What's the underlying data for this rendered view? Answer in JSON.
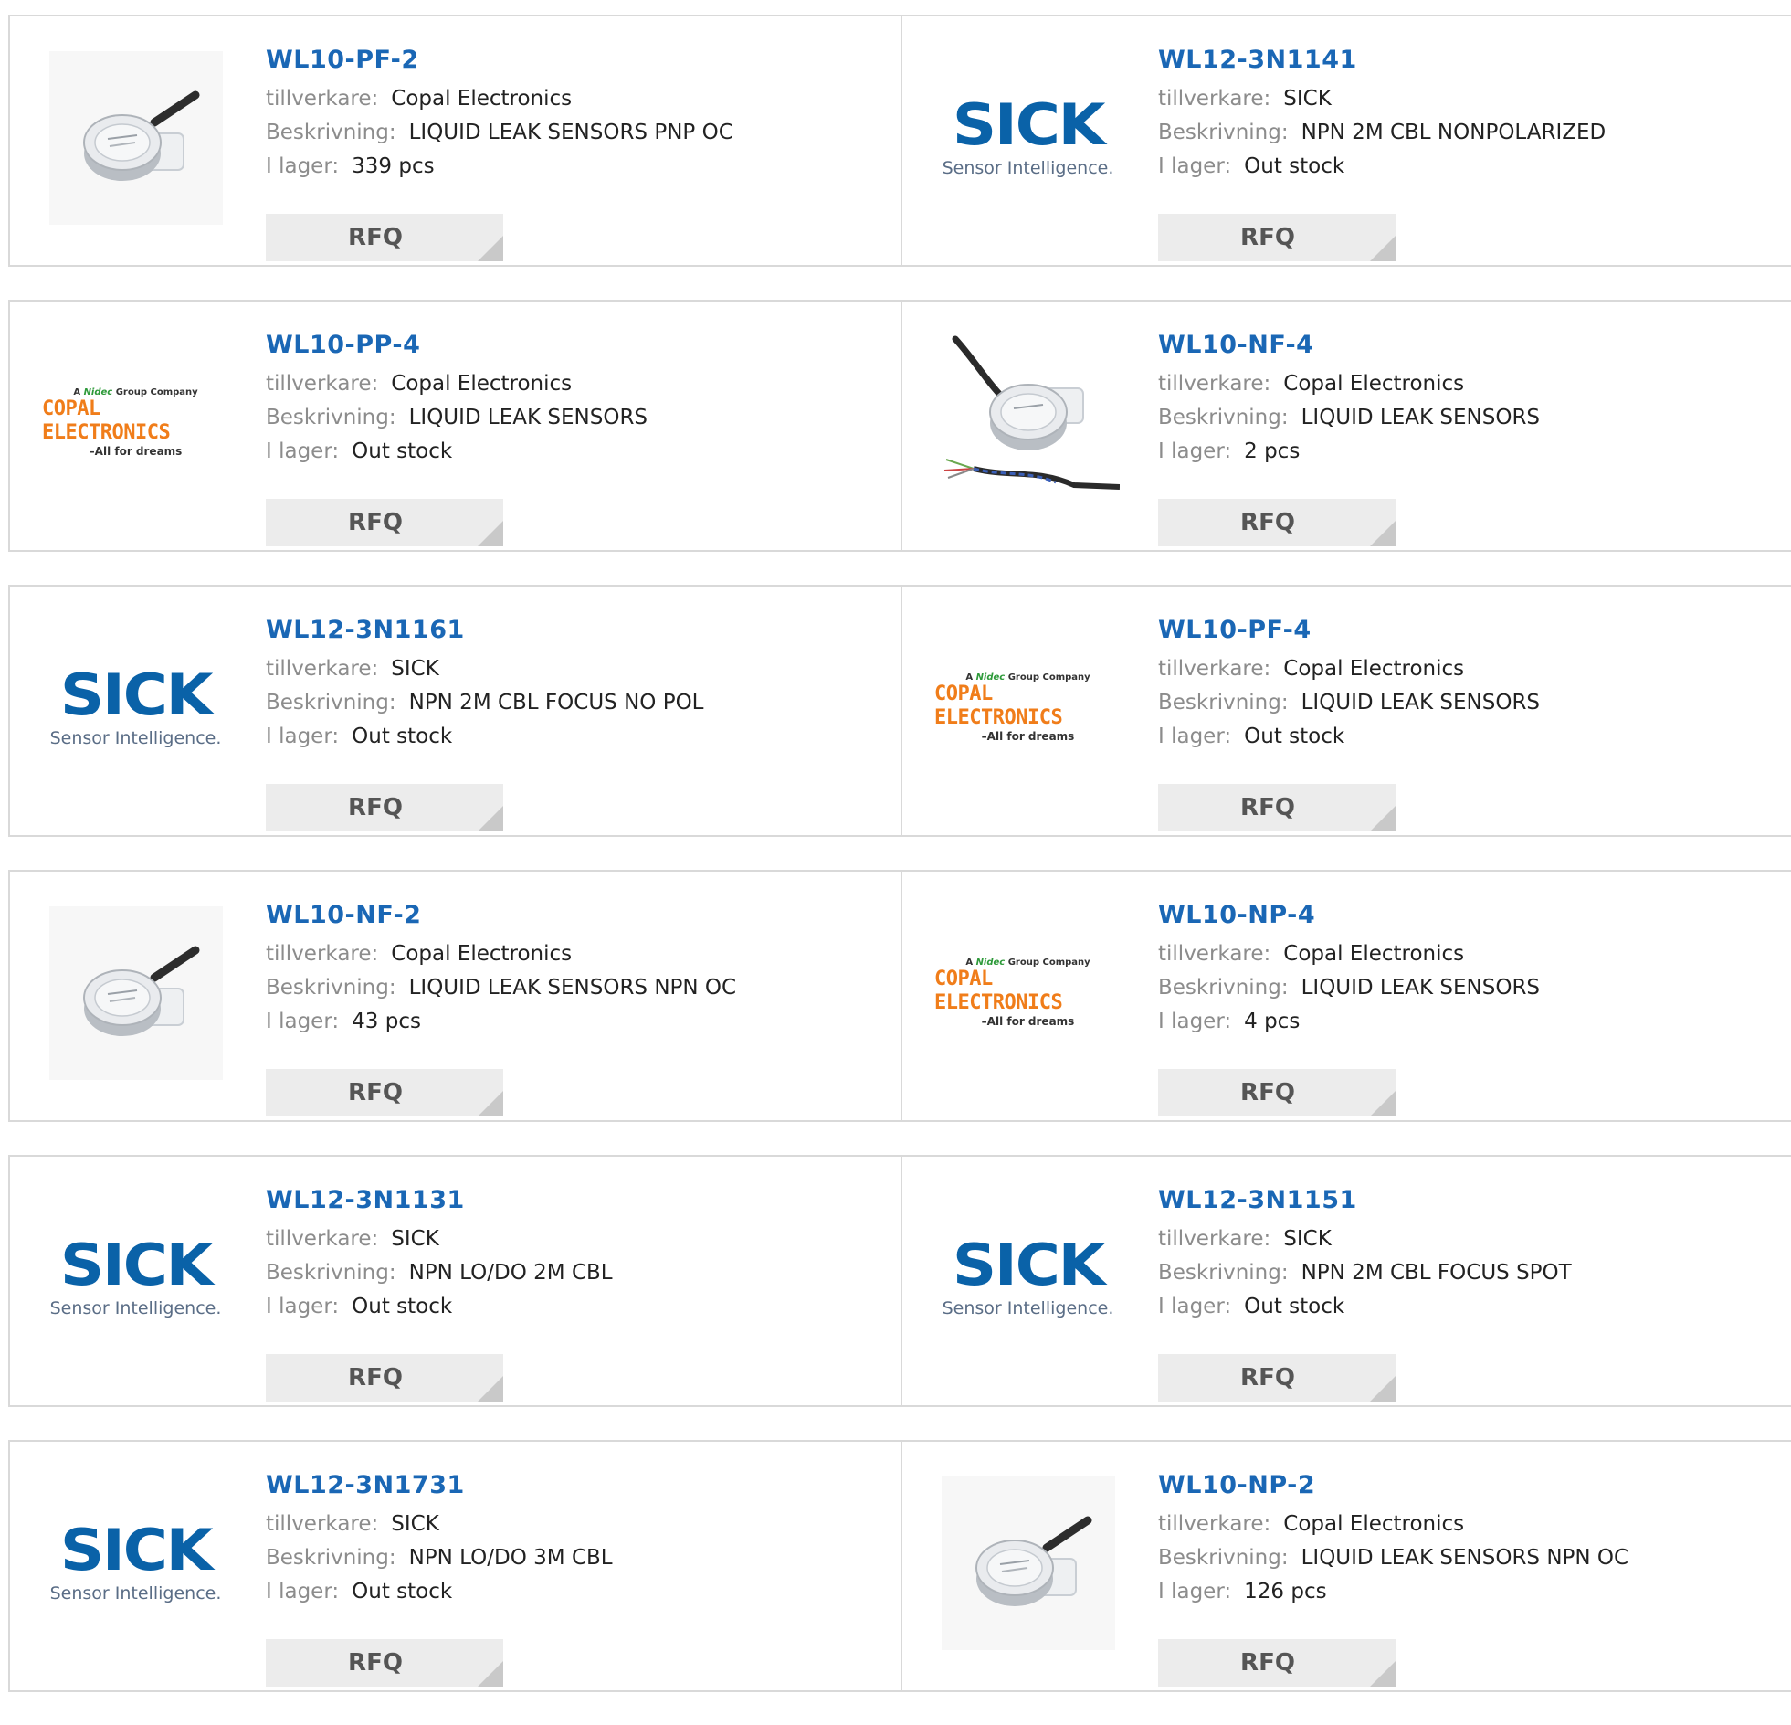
{
  "labels": {
    "manufacturer": "tillverkare:",
    "description": "Beskrivning:",
    "stock": "I lager:",
    "rfq": "RFQ"
  },
  "logos": {
    "sick_word": "SICK",
    "sick_tagline": "Sensor Intelligence.",
    "copal_top_prefix": "A",
    "copal_top_brand": "Nidec",
    "copal_top_suffix": "Group Company",
    "copal_main": "COPAL ELECTRONICS",
    "copal_slogan": "–All for dreams"
  },
  "colors": {
    "link": "#1a67b5",
    "sick_blue": "#0a62a8",
    "copal_orange": "#f07d1a",
    "button_bg": "#ececec"
  },
  "products": [
    {
      "name": "WL10-PF-2",
      "image": "sensor-photo",
      "manufacturer": "Copal Electronics",
      "description": "LIQUID LEAK SENSORS PNP OC",
      "stock": "339 pcs"
    },
    {
      "name": "WL12-3N1141",
      "image": "sick-logo",
      "manufacturer": "SICK",
      "description": "NPN 2M CBL NONPOLARIZED",
      "stock": "Out stock"
    },
    {
      "name": "WL10-PP-4",
      "image": "copal-logo",
      "manufacturer": "Copal Electronics",
      "description": "LIQUID LEAK SENSORS",
      "stock": "Out stock"
    },
    {
      "name": "WL10-NF-4",
      "image": "sensor-cable-photo",
      "manufacturer": "Copal Electronics",
      "description": "LIQUID LEAK SENSORS",
      "stock": "2 pcs"
    },
    {
      "name": "WL12-3N1161",
      "image": "sick-logo",
      "manufacturer": "SICK",
      "description": "NPN 2M CBL FOCUS NO POL",
      "stock": "Out stock"
    },
    {
      "name": "WL10-PF-4",
      "image": "copal-logo",
      "manufacturer": "Copal Electronics",
      "description": "LIQUID LEAK SENSORS",
      "stock": "Out stock"
    },
    {
      "name": "WL10-NF-2",
      "image": "sensor-photo",
      "manufacturer": "Copal Electronics",
      "description": "LIQUID LEAK SENSORS NPN OC",
      "stock": "43 pcs"
    },
    {
      "name": "WL10-NP-4",
      "image": "copal-logo",
      "manufacturer": "Copal Electronics",
      "description": "LIQUID LEAK SENSORS",
      "stock": "4 pcs"
    },
    {
      "name": "WL12-3N1131",
      "image": "sick-logo",
      "manufacturer": "SICK",
      "description": "NPN LO/DO 2M CBL",
      "stock": "Out stock"
    },
    {
      "name": "WL12-3N1151",
      "image": "sick-logo",
      "manufacturer": "SICK",
      "description": "NPN 2M CBL FOCUS SPOT",
      "stock": "Out stock"
    },
    {
      "name": "WL12-3N1731",
      "image": "sick-logo",
      "manufacturer": "SICK",
      "description": "NPN LO/DO 3M CBL",
      "stock": "Out stock"
    },
    {
      "name": "WL10-NP-2",
      "image": "sensor-photo",
      "manufacturer": "Copal Electronics",
      "description": "LIQUID LEAK SENSORS NPN OC",
      "stock": "126 pcs"
    }
  ]
}
